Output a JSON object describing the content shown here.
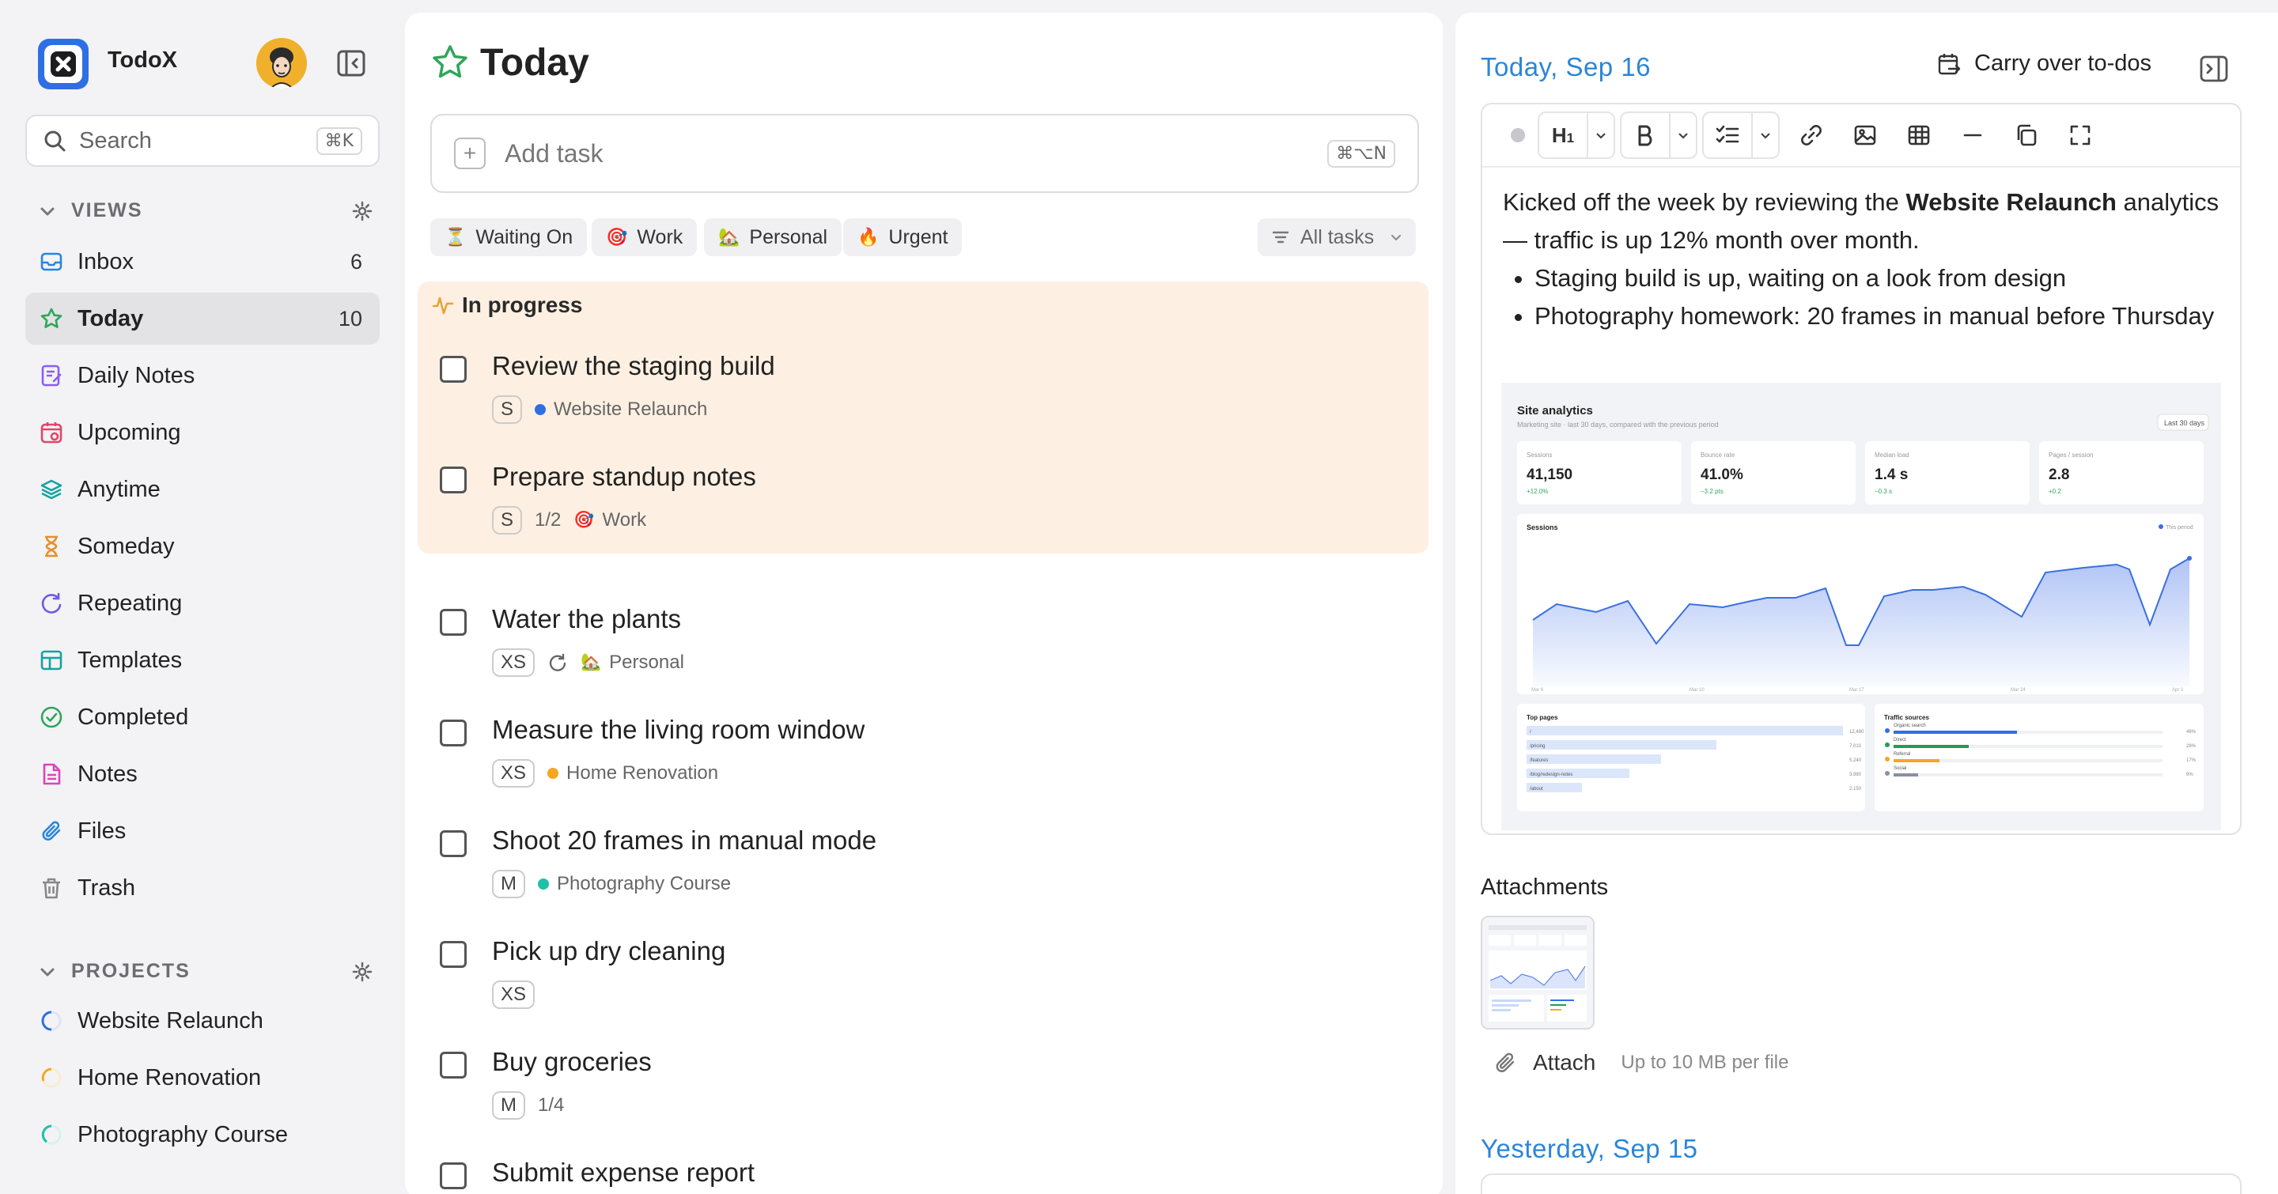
{
  "app": {
    "name": "TodoX"
  },
  "search": {
    "placeholder": "Search",
    "shortcut": "⌘K"
  },
  "views": {
    "label": "VIEWS",
    "items": [
      {
        "label": "Inbox",
        "count": "6",
        "icon": "inbox-icon",
        "color": "#2a86d8"
      },
      {
        "label": "Today",
        "count": "10",
        "icon": "star-icon",
        "color": "#2fa55b"
      },
      {
        "label": "Daily Notes",
        "count": "",
        "icon": "daily-notes-icon",
        "color": "#8b5cf6"
      },
      {
        "label": "Upcoming",
        "count": "",
        "icon": "calendar-icon",
        "color": "#e0466b"
      },
      {
        "label": "Anytime",
        "count": "",
        "icon": "layers-icon",
        "color": "#14a3a0"
      },
      {
        "label": "Someday",
        "count": "",
        "icon": "hourglass-icon",
        "color": "#e5912b"
      },
      {
        "label": "Repeating",
        "count": "",
        "icon": "repeat-icon",
        "color": "#6d5ae6"
      },
      {
        "label": "Templates",
        "count": "",
        "icon": "template-icon",
        "color": "#14a3a0"
      },
      {
        "label": "Completed",
        "count": "",
        "icon": "check-circle-icon",
        "color": "#2fa55b"
      },
      {
        "label": "Notes",
        "count": "",
        "icon": "note-icon",
        "color": "#d946b9"
      },
      {
        "label": "Files",
        "count": "",
        "icon": "paperclip-icon",
        "color": "#2a86d8"
      },
      {
        "label": "Trash",
        "count": "",
        "icon": "trash-icon",
        "color": "#888888"
      }
    ]
  },
  "projects": {
    "label": "PROJECTS",
    "items": [
      {
        "label": "Website Relaunch",
        "color": "#2f6fe4"
      },
      {
        "label": "Home Renovation",
        "color": "#f5a623"
      },
      {
        "label": "Photography Course",
        "color": "#1fbfa8"
      }
    ]
  },
  "today": {
    "title": "Today",
    "add_placeholder": "Add task",
    "add_shortcut": "⌘⌥N",
    "chips": [
      {
        "emoji": "⏳",
        "label": "Waiting On"
      },
      {
        "emoji": "🎯",
        "label": "Work"
      },
      {
        "emoji": "🏡",
        "label": "Personal"
      },
      {
        "emoji": "🔥",
        "label": "Urgent"
      }
    ],
    "filter": "All tasks",
    "in_progress_label": "In progress",
    "in_progress": [
      {
        "title": "Review the staging build",
        "size": "S",
        "project": "Website Relaunch",
        "project_color": "#2f6fe4"
      },
      {
        "title": "Prepare standup notes",
        "size": "S",
        "progress": "1/2",
        "tag": "Work",
        "tag_emoji": "🎯"
      }
    ],
    "tasks": [
      {
        "title": "Water the plants",
        "size": "XS",
        "tag": "Personal",
        "tag_emoji": "🏡"
      },
      {
        "title": "Measure the living room window",
        "size": "XS",
        "project": "Home Renovation",
        "project_color": "#f5a623"
      },
      {
        "title": "Shoot 20 frames in manual mode",
        "size": "M",
        "project": "Photography Course",
        "project_color": "#1fbfa8"
      },
      {
        "title": "Pick up dry cleaning",
        "size": "XS"
      },
      {
        "title": "Buy groceries",
        "size": "M",
        "progress": "1/4"
      },
      {
        "title": "Submit expense report"
      }
    ]
  },
  "daily": {
    "date": "Today, Sep 16",
    "carry_over": "Carry over to-dos",
    "note": {
      "p1_before": "Kicked off the week by reviewing the ",
      "p1_bold": "Website Relaunch",
      "p1_after": " analytics — traffic is up 12% month over month.",
      "bullets": [
        "Staging build is up, waiting on a look from design",
        "Photography homework: 20 frames in manual before Thursday"
      ]
    },
    "screenshot": {
      "title": "Site analytics",
      "subtitle": "Marketing site · last 30 days, compared with the previous period",
      "range": "Last 30 days",
      "kpis": [
        {
          "label": "Sessions",
          "value": "41,150",
          "delta": "+12.0%"
        },
        {
          "label": "Bounce rate",
          "value": "41.0%",
          "delta": "−3.2 pts"
        },
        {
          "label": "Median load",
          "value": "1.4 s",
          "delta": "−0.3 s"
        },
        {
          "label": "Pages / session",
          "value": "2.8",
          "delta": "+0.2"
        }
      ],
      "chart_label": "Sessions",
      "legend": "This period",
      "x_ticks": [
        "Mar 6",
        "Mar 10",
        "Mar 17",
        "Mar 24",
        "Apr 1"
      ],
      "top_pages_label": "Top pages",
      "top_pages": [
        {
          "path": "/",
          "value": "12,480"
        },
        {
          "path": "/pricing",
          "value": "7,010"
        },
        {
          "path": "/features",
          "value": "5,240"
        },
        {
          "path": "/blog/redesign-notes",
          "value": "3,980"
        },
        {
          "path": "/about",
          "value": "2,150"
        }
      ],
      "traffic_label": "Traffic sources",
      "traffic": [
        {
          "name": "Organic search",
          "pct": "46%"
        },
        {
          "name": "Direct",
          "pct": "28%"
        },
        {
          "name": "Referral",
          "pct": "17%"
        },
        {
          "name": "Social",
          "pct": "9%"
        }
      ]
    },
    "attachments_label": "Attachments",
    "attach_label": "Attach",
    "attach_hint": "Up to 10 MB per file",
    "yesterday": "Yesterday, Sep 15"
  }
}
